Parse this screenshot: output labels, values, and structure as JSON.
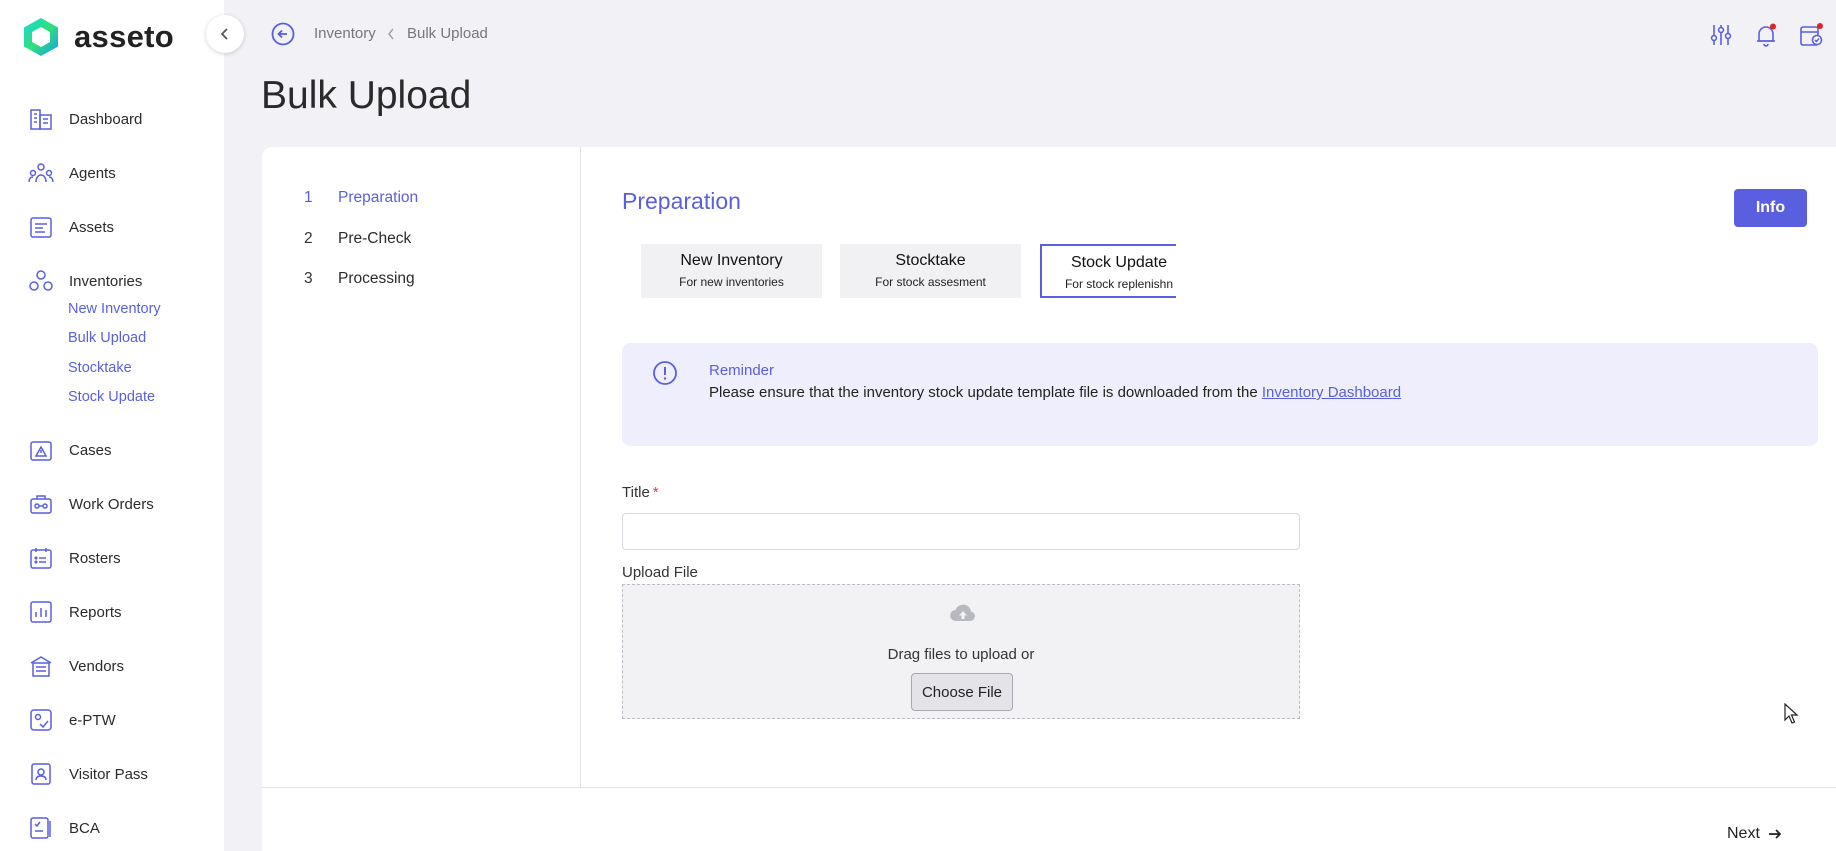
{
  "app": {
    "name": "asseto",
    "accent": "#5a5fe0"
  },
  "sidebar": {
    "items": [
      {
        "label": "Dashboard",
        "icon": "dashboard-icon"
      },
      {
        "label": "Agents",
        "icon": "agents-icon"
      },
      {
        "label": "Assets",
        "icon": "assets-icon"
      },
      {
        "label": "Inventories",
        "icon": "inventories-icon"
      },
      {
        "label": "Cases",
        "icon": "cases-icon"
      },
      {
        "label": "Work Orders",
        "icon": "work-orders-icon"
      },
      {
        "label": "Rosters",
        "icon": "rosters-icon"
      },
      {
        "label": "Reports",
        "icon": "reports-icon"
      },
      {
        "label": "Vendors",
        "icon": "vendors-icon"
      },
      {
        "label": "e-PTW",
        "icon": "eptw-icon"
      },
      {
        "label": "Visitor Pass",
        "icon": "visitor-pass-icon"
      },
      {
        "label": "BCA",
        "icon": "bca-icon"
      }
    ],
    "inventory_subitems": [
      "New Inventory",
      "Bulk Upload",
      "Stocktake",
      "Stock Update"
    ]
  },
  "breadcrumb": {
    "parent": "Inventory",
    "current": "Bulk Upload"
  },
  "page": {
    "title": "Bulk Upload"
  },
  "steps": [
    {
      "num": "1",
      "label": "Preparation"
    },
    {
      "num": "2",
      "label": "Pre-Check"
    },
    {
      "num": "3",
      "label": "Processing"
    }
  ],
  "section": {
    "title": "Preparation",
    "info_label": "Info"
  },
  "upload_types": [
    {
      "title": "New Inventory",
      "subtitle": "For new inventories"
    },
    {
      "title": "Stocktake",
      "subtitle": "For stock assesment"
    },
    {
      "title": "Stock Update",
      "subtitle": "For stock replenishn"
    }
  ],
  "selected_upload_type": "Stock Update",
  "reminder": {
    "title": "Reminder",
    "text": "Please ensure that the inventory stock update template file is downloaded from the ",
    "link": "Inventory Dashboard"
  },
  "form": {
    "title_label": "Title",
    "required_mark": "*",
    "title_value": "",
    "upload_label": "Upload File",
    "drag_text": "Drag files to upload or",
    "choose_label": "Choose File"
  },
  "footer": {
    "next_label": "Next"
  }
}
